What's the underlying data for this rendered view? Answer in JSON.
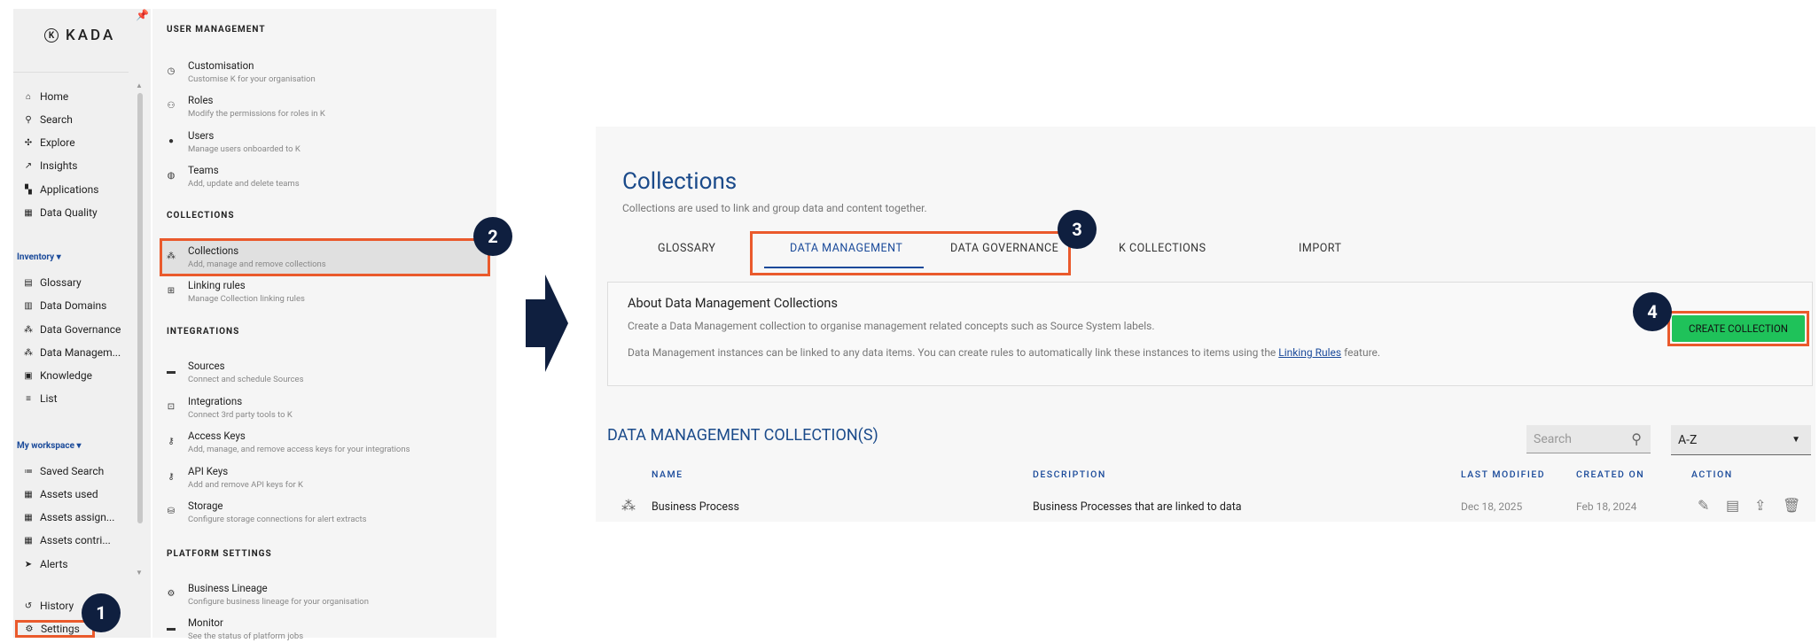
{
  "leftnav": {
    "brand": "KADA",
    "items": [
      {
        "label": "Home",
        "icon": "home-icon"
      },
      {
        "label": "Search",
        "icon": "search-icon"
      },
      {
        "label": "Explore",
        "icon": "explore-icon"
      },
      {
        "label": "Insights",
        "icon": "trend-icon"
      },
      {
        "label": "Applications",
        "icon": "apps-icon"
      },
      {
        "label": "Data Quality",
        "icon": "quality-icon"
      }
    ],
    "inventory_label": "Inventory",
    "inventory": [
      {
        "label": "Glossary"
      },
      {
        "label": "Data Domains"
      },
      {
        "label": "Data Governance"
      },
      {
        "label": "Data Managem..."
      },
      {
        "label": "Knowledge"
      },
      {
        "label": "List"
      }
    ],
    "workspace_label": "My workspace",
    "workspace": [
      {
        "label": "Saved Search"
      },
      {
        "label": "Assets used"
      },
      {
        "label": "Assets assign..."
      },
      {
        "label": "Assets contri..."
      },
      {
        "label": "Alerts"
      }
    ],
    "history": "History",
    "settings": "Settings"
  },
  "settings_panel": {
    "user_mgmt": "USER MANAGEMENT",
    "customisation": {
      "title": "Customisation",
      "desc": "Customise K for your organisation"
    },
    "roles": {
      "title": "Roles",
      "desc": "Modify the permissions for roles in K"
    },
    "users": {
      "title": "Users",
      "desc": "Manage users onboarded to K"
    },
    "teams": {
      "title": "Teams",
      "desc": "Add, update and delete teams"
    },
    "collections_head": "COLLECTIONS",
    "collections": {
      "title": "Collections",
      "desc": "Add, manage and remove collections"
    },
    "linking": {
      "title": "Linking rules",
      "desc": "Manage Collection linking rules"
    },
    "integrations_head": "INTEGRATIONS",
    "sources": {
      "title": "Sources",
      "desc": "Connect and schedule Sources"
    },
    "integrations": {
      "title": "Integrations",
      "desc": "Connect 3rd party tools to K"
    },
    "access_keys": {
      "title": "Access Keys",
      "desc": "Add, manage, and remove access keys for your integrations"
    },
    "api_keys": {
      "title": "API Keys",
      "desc": "Add and remove API keys for K"
    },
    "storage": {
      "title": "Storage",
      "desc": "Configure storage connections for alert extracts"
    },
    "platform_head": "PLATFORM SETTINGS",
    "lineage": {
      "title": "Business Lineage",
      "desc": "Configure business lineage for your organisation"
    },
    "monitor": {
      "title": "Monitor",
      "desc": "See the status of platform jobs"
    }
  },
  "badges": {
    "b1": "1",
    "b2": "2",
    "b3": "3",
    "b4": "4"
  },
  "main": {
    "title": "Collections",
    "subtitle": "Collections are used to link and group data and content together.",
    "tabs": [
      "GLOSSARY",
      "DATA MANAGEMENT",
      "DATA GOVERNANCE",
      "K COLLECTIONS",
      "IMPORT"
    ],
    "about_title": "About Data Management Collections",
    "about_p1": "Create a Data Management collection to organise management related concepts such as Source System labels.",
    "about_p2_pre": "Data Management instances can be linked to any data items. You can create rules to automatically link these instances to items using the ",
    "about_p2_link": "Linking Rules",
    "about_p2_post": " feature.",
    "create_btn": "CREATE COLLECTION",
    "list_title": "DATA MANAGEMENT COLLECTION(S)",
    "search_placeholder": "Search",
    "sort_value": "A-Z",
    "columns": [
      "NAME",
      "DESCRIPTION",
      "LAST MODIFIED",
      "CREATED ON",
      "ACTION"
    ],
    "row": {
      "name": "Business Process",
      "desc": "Business Processes that are linked to data",
      "modified": "Dec 18, 2025",
      "created": "Feb 18, 2024"
    }
  }
}
